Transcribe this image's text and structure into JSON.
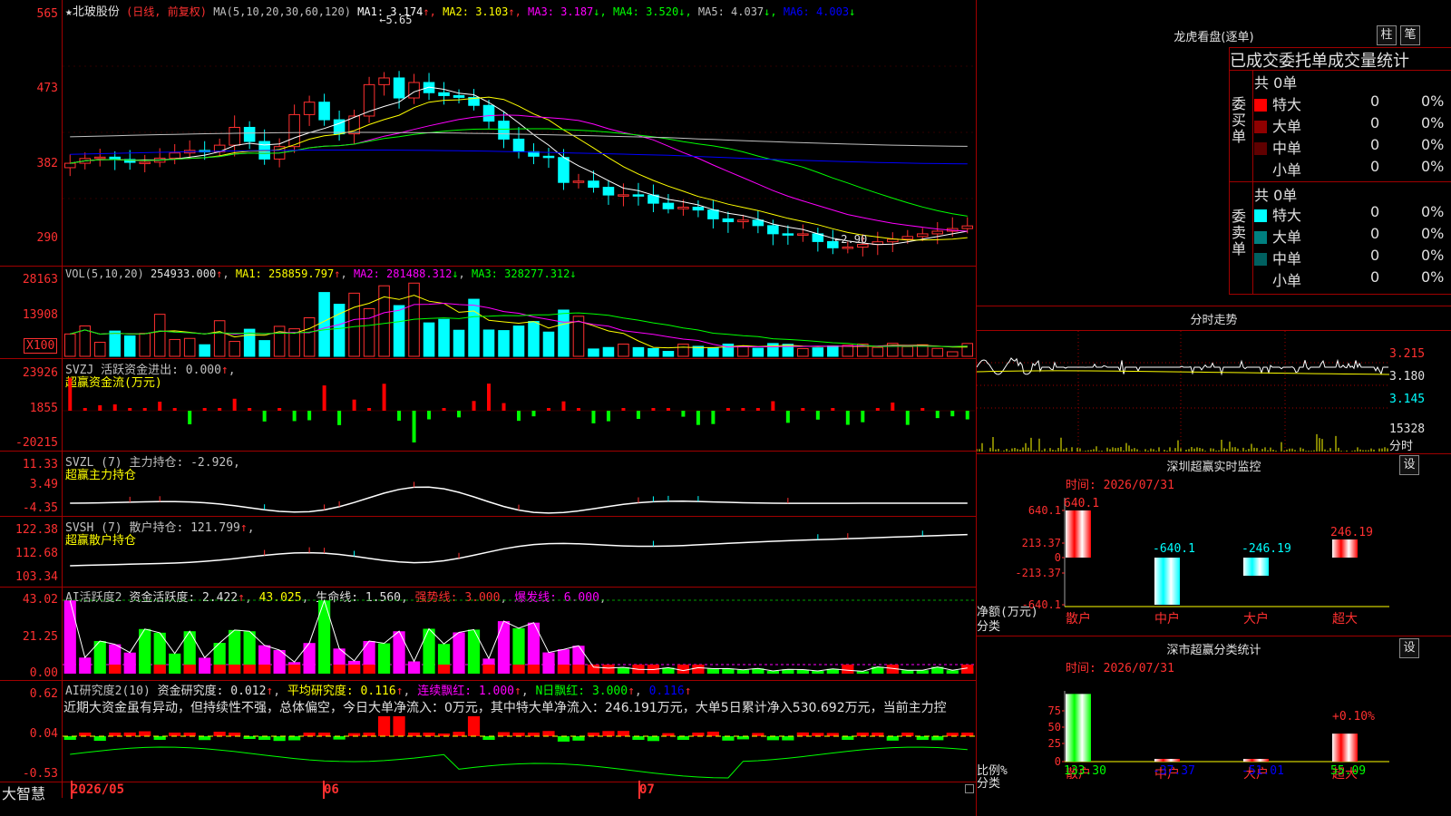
{
  "stock": {
    "name": "★北玻股份",
    "mode": "(日线, 前复权)",
    "ma_label": "MA(5,10,20,30,60,120)",
    "ma_values": [
      {
        "label": "MA1: 3.174",
        "arrow": "↑",
        "color": "#ffffff"
      },
      {
        "label": "MA2: 3.103",
        "arrow": "↑",
        "color": "#ffff00"
      },
      {
        "label": "MA3: 3.187",
        "arrow": "↓",
        "color": "#ff00ff"
      },
      {
        "label": "MA4: 3.520",
        "arrow": "↓",
        "color": "#00ff00"
      },
      {
        "label": "MA5: 4.037",
        "arrow": "↓",
        "color": "#c0c0c0"
      },
      {
        "label": "MA6: 4.003",
        "arrow": "↓",
        "color": "#0000ff"
      }
    ],
    "high_label": "5.65",
    "low_label": "2.90"
  },
  "price_axis": [
    "565",
    "473",
    "382",
    "290"
  ],
  "volume": {
    "header_left": "VOL(5,10,20)",
    "header_val": "254933.000",
    "ma1": "MA1: 258859.797",
    "ma2": "MA2: 281488.312",
    "ma3": "MA3: 328277.312",
    "axis": [
      "28163",
      "13908"
    ],
    "unit": "X100"
  },
  "svzj": {
    "header": "SVZJ  活跃资金进出: 0.000",
    "sub": "超赢资金流(万元)",
    "axis": [
      "23926",
      "1855",
      "-20215"
    ]
  },
  "svzl": {
    "header": "SVZL (7) 主力持仓: -2.926,",
    "sub": "超赢主力持仓",
    "axis": [
      "11.33",
      "3.49",
      "-4.35"
    ]
  },
  "svsh": {
    "header": "SVSH (7) 散户持仓: 121.799",
    "sub": "超赢散户持仓",
    "axis": [
      "122.38",
      "112.68",
      "103.34"
    ]
  },
  "ai1": {
    "name": "AI活跃度2",
    "v1": "资金活跃度: 2.422",
    "v2": "43.025",
    "v3": "生命线: 1.560",
    "v4": "强势线: 3.000",
    "v5": "爆发线: 6.000",
    "axis": [
      "43.02",
      "21.25",
      "0.00"
    ]
  },
  "ai2": {
    "name": "AI研究度2(10)",
    "v1": "资金研究度: 0.012",
    "v2": "平均研究度: 0.116",
    "v3": "连续飘红: 1.000",
    "v4": "N日飘红: 3.000",
    "v5": "0.116",
    "comment": "近期大资金虽有异动，但持续性不强，总体偏空，今日大单净流入：0万元，其中特大单净流入：246.191万元，大单5日累计净入530.692万元，当前主力控",
    "axis": [
      "0.62",
      "0.04",
      "-0.53"
    ]
  },
  "date_axis": {
    "logo": "大智慧",
    "labels": [
      "2026/05",
      "06",
      "07"
    ]
  },
  "dragon": {
    "title": "龙虎看盘(逐单)",
    "btn1": "柱",
    "btn2": "笔",
    "tabs": "已成交委托单成交量统计",
    "buy_label": "委买单",
    "sell_label": "委卖单",
    "buy_total": "共 0单",
    "sell_total": "共 0单",
    "buy_rows": [
      {
        "name": "特大",
        "count": "0",
        "pct": "0%",
        "color": "#ff0000"
      },
      {
        "name": "大单",
        "count": "0",
        "pct": "0%",
        "color": "#900000"
      },
      {
        "name": "中单",
        "count": "0",
        "pct": "0%",
        "color": "#600000"
      },
      {
        "name": "小单",
        "count": "0",
        "pct": "0%",
        "color": "#000000"
      }
    ],
    "sell_rows": [
      {
        "name": "特大",
        "count": "0",
        "pct": "0%",
        "color": "#00ffff"
      },
      {
        "name": "大单",
        "count": "0",
        "pct": "0%",
        "color": "#008080"
      },
      {
        "name": "中单",
        "count": "0",
        "pct": "0%",
        "color": "#006060"
      },
      {
        "name": "小单",
        "count": "0",
        "pct": "0%",
        "color": "#000000"
      }
    ]
  },
  "intraday": {
    "title": "分时走势",
    "prices": [
      "3.215",
      "3.180",
      "3.145"
    ],
    "vol": "15328",
    "vol_unit": "分时"
  },
  "sz_monitor": {
    "title": "深圳超赢实时监控",
    "btn": "设",
    "time": "时间: 2026/07/31",
    "axis": [
      "640.1",
      "213.37",
      "0",
      "-213.37",
      "-640.1"
    ],
    "ylabel": "净额(万元)",
    "xlabel": "分类",
    "categories": [
      "散户",
      "中户",
      "大户",
      "超大"
    ],
    "values": [
      640.1,
      -640.1,
      -246.19,
      246.19
    ],
    "value_labels": [
      "640.1",
      "-640.1",
      "-246.19",
      "246.19"
    ]
  },
  "sz_class": {
    "title": "深市超赢分类统计",
    "btn": "设",
    "time": "时间: 2026/07/31",
    "axis": [
      "75",
      "50",
      "25",
      "0"
    ],
    "ylabel": "比例%",
    "xlabel": "分类",
    "categories": [
      "散户",
      "中户",
      "大户",
      "超大"
    ],
    "values": [
      133.3,
      -37.37,
      -51.01,
      55.09
    ],
    "value_labels": [
      "133.30",
      "-37.37",
      "-51.01",
      "55.09"
    ],
    "top_label": "+0.10%"
  }
}
